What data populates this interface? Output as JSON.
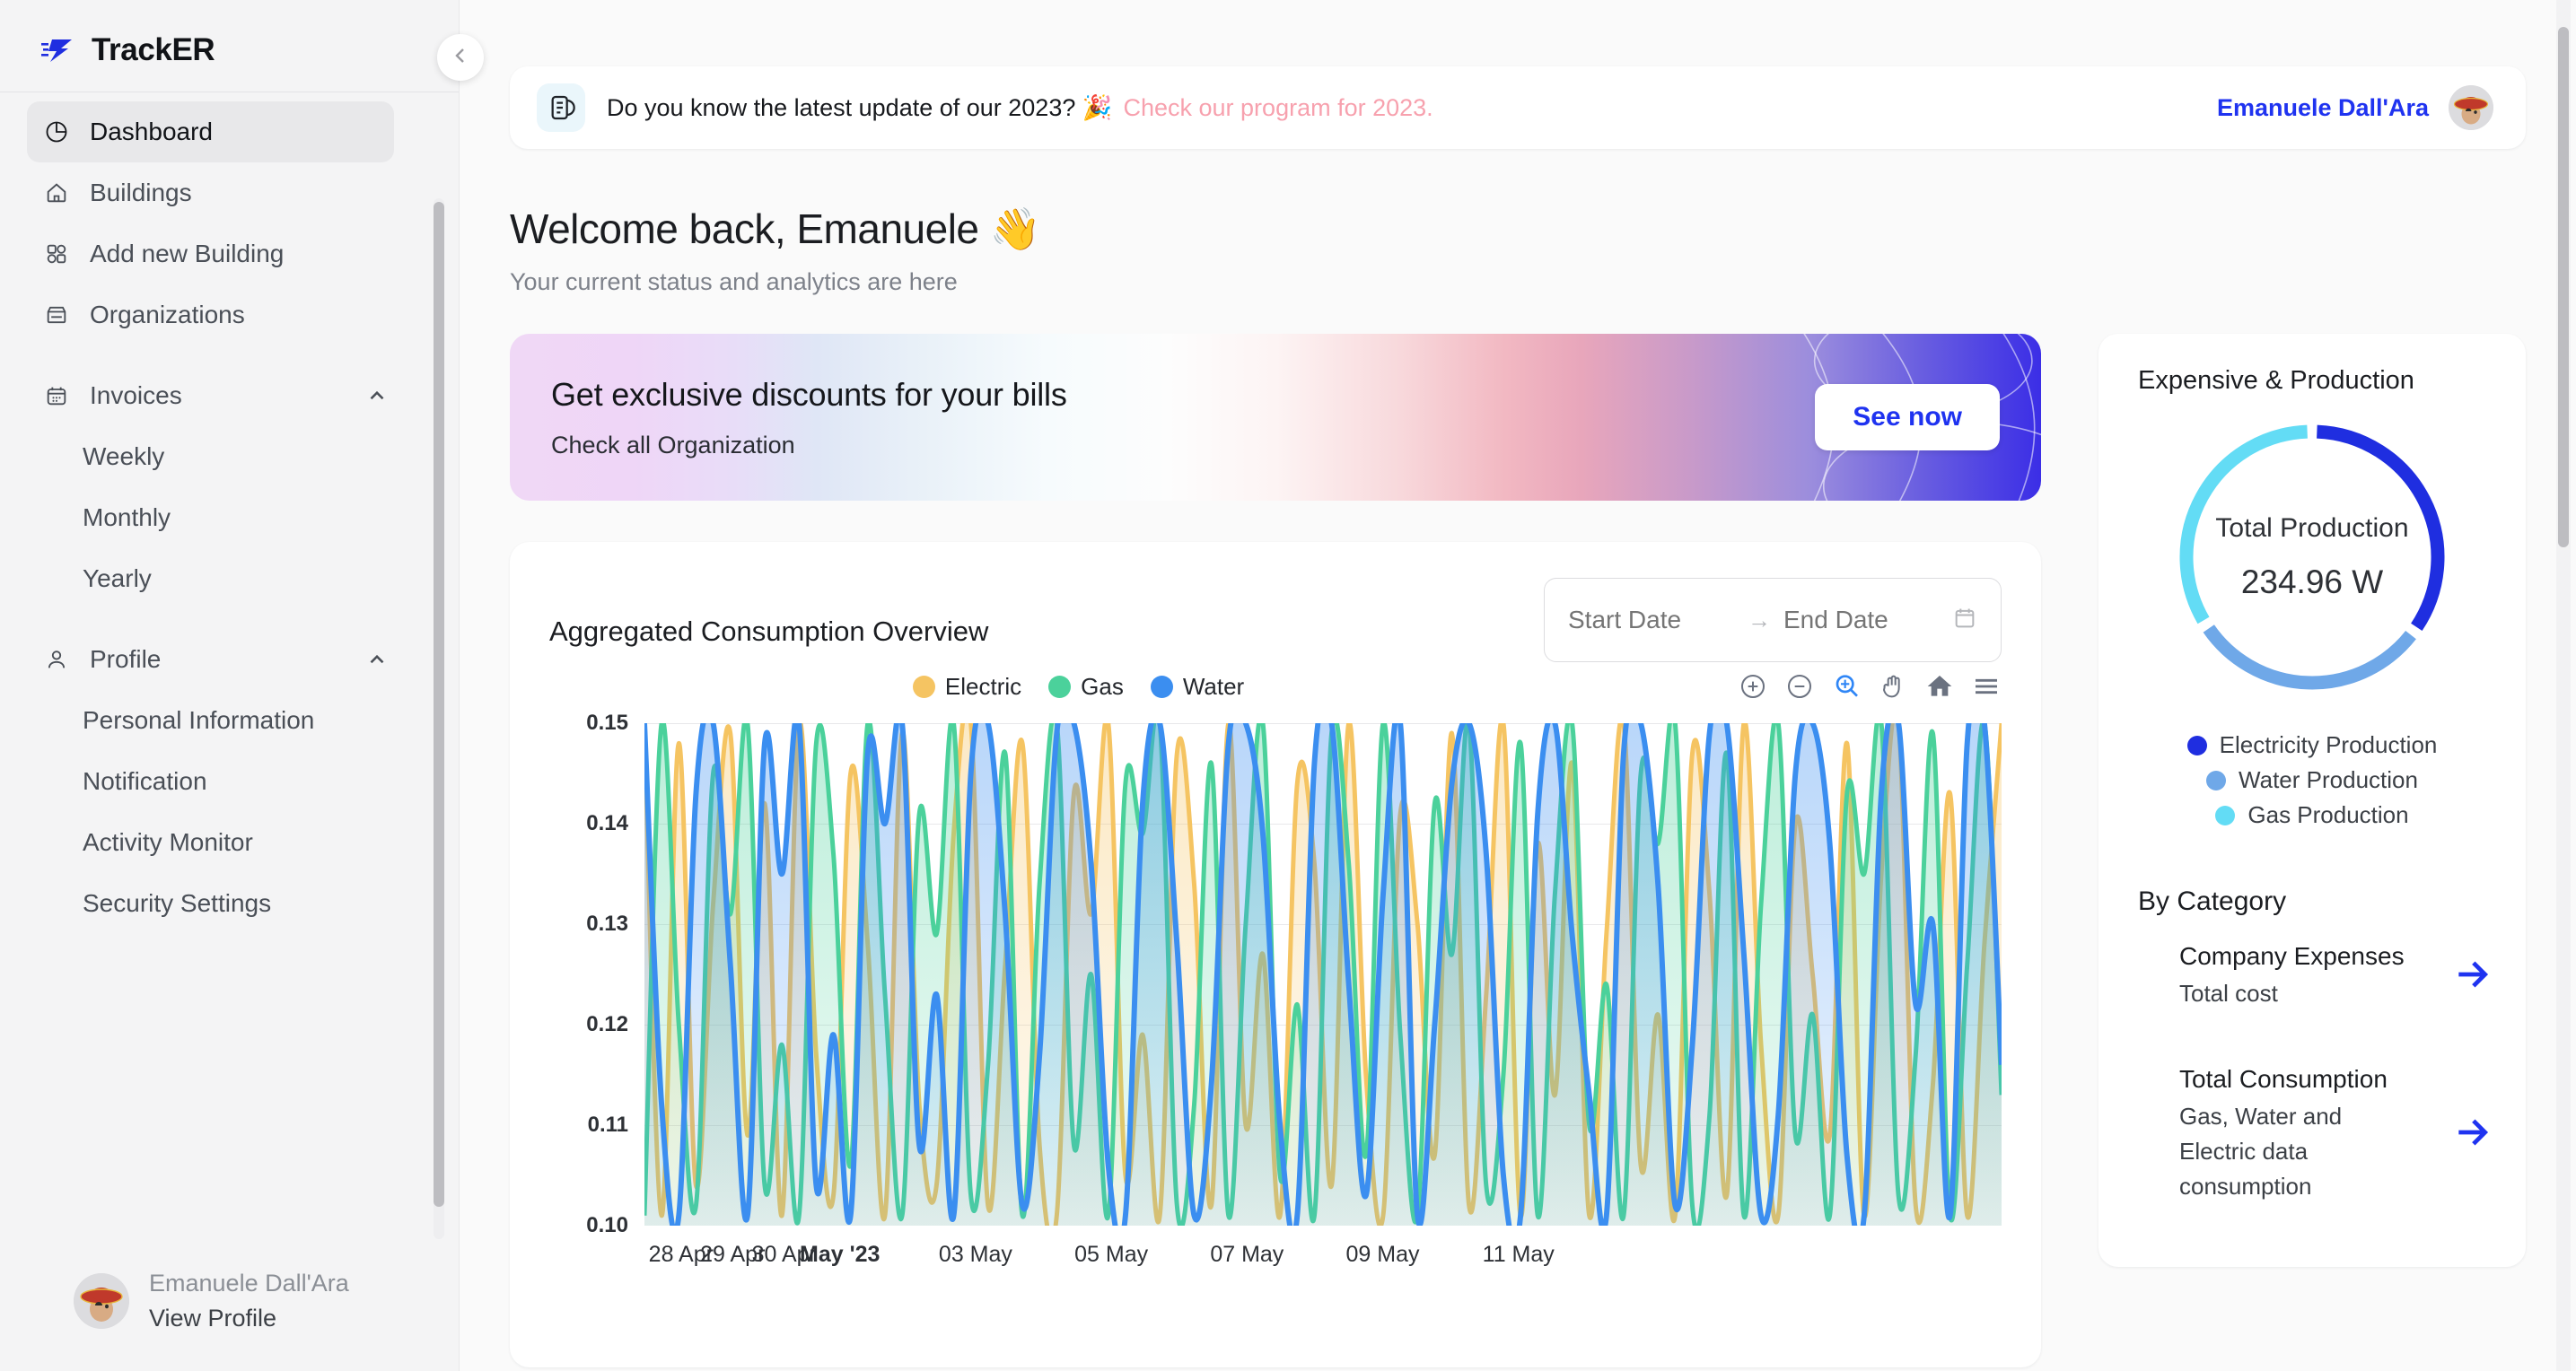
{
  "brand": {
    "name": "TrackER",
    "logo_icon": "lightning-logo-icon"
  },
  "sidebar": {
    "items": [
      {
        "label": "Dashboard",
        "icon": "pie-chart-icon",
        "active": true
      },
      {
        "label": "Buildings",
        "icon": "home-icon",
        "active": false
      },
      {
        "label": "Add new Building",
        "icon": "grid-squares-icon",
        "active": false
      },
      {
        "label": "Organizations",
        "icon": "store-icon",
        "active": false
      }
    ],
    "groups": [
      {
        "label": "Invoices",
        "icon": "calendar-icon",
        "expanded": true,
        "caret_icon": "chevron-up-icon",
        "children": [
          {
            "label": "Weekly"
          },
          {
            "label": "Monthly"
          },
          {
            "label": "Yearly"
          }
        ]
      },
      {
        "label": "Profile",
        "icon": "user-icon",
        "expanded": true,
        "caret_icon": "chevron-up-icon",
        "children": [
          {
            "label": "Personal Information"
          },
          {
            "label": "Notification"
          },
          {
            "label": "Activity Monitor"
          },
          {
            "label": "Security Settings"
          }
        ]
      }
    ],
    "profile": {
      "name": "Emanuele Dall'Ara",
      "link": "View Profile",
      "avatar_icon": "user-avatar"
    },
    "collapse_icon": "chevron-left-icon"
  },
  "topbar": {
    "doc_icon": "document-icon",
    "message": "Do you know the latest update of our 2023? 🎉",
    "link_text": "Check our program for 2023.",
    "user_name": "Emanuele Dall'Ara",
    "avatar_icon": "user-avatar",
    "link_color": "#f7a1ae",
    "user_color": "#1f33f0"
  },
  "welcome": {
    "heading": "Welcome back, Emanuele 👋",
    "subtitle": "Your current status and analytics are here"
  },
  "promo": {
    "title": "Get exclusive discounts for your bills",
    "subtitle": "Check all Organization",
    "button_label": "See now",
    "button_color": "#1f33f0"
  },
  "chart_card": {
    "title": "Aggregated Consumption Overview",
    "date_range": {
      "start_placeholder": "Start Date",
      "end_placeholder": "End Date",
      "start_value": "",
      "end_value": "",
      "arrow": "→",
      "calendar_icon": "calendar-icon"
    },
    "tools": [
      {
        "name": "zoom-in-icon",
        "active": false
      },
      {
        "name": "zoom-out-icon",
        "active": false
      },
      {
        "name": "selection-zoom-icon",
        "active": true
      },
      {
        "name": "pan-icon",
        "active": false
      },
      {
        "name": "reset-home-icon",
        "active": false
      },
      {
        "name": "menu-icon",
        "active": false
      }
    ]
  },
  "chart_data": {
    "type": "area",
    "title": "Aggregated Consumption Overview",
    "xlabel": "",
    "ylabel": "",
    "ylim": [
      0.1,
      0.15
    ],
    "yticks": [
      "0.10",
      "0.11",
      "0.12",
      "0.13",
      "0.14",
      "0.15"
    ],
    "xticks": [
      "28 Apr",
      "29 Apr",
      "30 Apr",
      "May '23",
      "03 May",
      "05 May",
      "07 May",
      "09 May",
      "11 May"
    ],
    "xtick_bold": "May '23",
    "grid": true,
    "legend_position": "top-center",
    "curve": "smooth",
    "series": [
      {
        "name": "Electric",
        "color": "#f5c462",
        "values": [
          0.15,
          0.101,
          0.148,
          0.104,
          0.132,
          0.149,
          0.109,
          0.142,
          0.101,
          0.15,
          0.117,
          0.103,
          0.145,
          0.128,
          0.101,
          0.149,
          0.112,
          0.104,
          0.139,
          0.15,
          0.102,
          0.126,
          0.148,
          0.108,
          0.101,
          0.143,
          0.131,
          0.15,
          0.105,
          0.119,
          0.101,
          0.147,
          0.134,
          0.102,
          0.15,
          0.11,
          0.127,
          0.101,
          0.144,
          0.136,
          0.104,
          0.15,
          0.115,
          0.101,
          0.141,
          0.13,
          0.107,
          0.149,
          0.102,
          0.123,
          0.15,
          0.101,
          0.138,
          0.113,
          0.146,
          0.101,
          0.129,
          0.15,
          0.106,
          0.121,
          0.101,
          0.147,
          0.133,
          0.103,
          0.15,
          0.118,
          0.101,
          0.14,
          0.125,
          0.109,
          0.148,
          0.101,
          0.135,
          0.15,
          0.102,
          0.114,
          0.143,
          0.101,
          0.128,
          0.15
        ]
      },
      {
        "name": "Gas",
        "color": "#4bd19b",
        "values": [
          0.101,
          0.15,
          0.12,
          0.102,
          0.145,
          0.131,
          0.15,
          0.104,
          0.118,
          0.101,
          0.148,
          0.137,
          0.106,
          0.15,
          0.123,
          0.101,
          0.141,
          0.129,
          0.15,
          0.103,
          0.116,
          0.147,
          0.101,
          0.134,
          0.15,
          0.108,
          0.125,
          0.101,
          0.144,
          0.139,
          0.15,
          0.102,
          0.112,
          0.146,
          0.101,
          0.13,
          0.15,
          0.105,
          0.122,
          0.101,
          0.149,
          0.136,
          0.107,
          0.15,
          0.119,
          0.101,
          0.142,
          0.127,
          0.15,
          0.104,
          0.115,
          0.148,
          0.101,
          0.133,
          0.15,
          0.11,
          0.124,
          0.101,
          0.145,
          0.138,
          0.15,
          0.102,
          0.111,
          0.147,
          0.101,
          0.132,
          0.15,
          0.109,
          0.121,
          0.101,
          0.143,
          0.135,
          0.15,
          0.103,
          0.117,
          0.149,
          0.101,
          0.126,
          0.15,
          0.113
        ]
      },
      {
        "name": "Water",
        "color": "#3b8ef0",
        "values": [
          0.15,
          0.112,
          0.101,
          0.143,
          0.15,
          0.126,
          0.101,
          0.148,
          0.135,
          0.15,
          0.104,
          0.119,
          0.101,
          0.147,
          0.14,
          0.15,
          0.108,
          0.123,
          0.101,
          0.145,
          0.15,
          0.131,
          0.102,
          0.117,
          0.149,
          0.15,
          0.136,
          0.106,
          0.101,
          0.142,
          0.15,
          0.128,
          0.101,
          0.114,
          0.148,
          0.15,
          0.139,
          0.11,
          0.101,
          0.146,
          0.15,
          0.124,
          0.103,
          0.133,
          0.15,
          0.101,
          0.12,
          0.144,
          0.15,
          0.137,
          0.105,
          0.101,
          0.141,
          0.15,
          0.129,
          0.113,
          0.101,
          0.147,
          0.15,
          0.134,
          0.102,
          0.118,
          0.149,
          0.15,
          0.127,
          0.101,
          0.111,
          0.145,
          0.15,
          0.138,
          0.107,
          0.101,
          0.143,
          0.15,
          0.122,
          0.13,
          0.101,
          0.148,
          0.15,
          0.116
        ]
      }
    ]
  },
  "right_panel": {
    "title": "Expensive & Production",
    "donut": {
      "center_label": "Total Production",
      "center_value": "234.96 W",
      "segments": [
        {
          "name": "Electricity Production",
          "color": "#1f2ee0",
          "percent": 35
        },
        {
          "name": "Water Production",
          "color": "#6fa8e8",
          "percent": 31
        },
        {
          "name": "Gas Production",
          "color": "#63dcf5",
          "percent": 34
        }
      ]
    },
    "legend": [
      {
        "label": "Electricity Production",
        "color": "#1f2ee0"
      },
      {
        "label": "Water Production",
        "color": "#6fa8e8"
      },
      {
        "label": "Gas Production",
        "color": "#63dcf5"
      }
    ],
    "by_category_title": "By Category",
    "categories": [
      {
        "title": "Company Expenses",
        "subtitle": "Total cost",
        "arrow_icon": "arrow-right-icon"
      },
      {
        "title": "Total Consumption",
        "subtitle": "Gas, Water and Electric data consumption",
        "arrow_icon": "arrow-right-icon"
      }
    ]
  }
}
